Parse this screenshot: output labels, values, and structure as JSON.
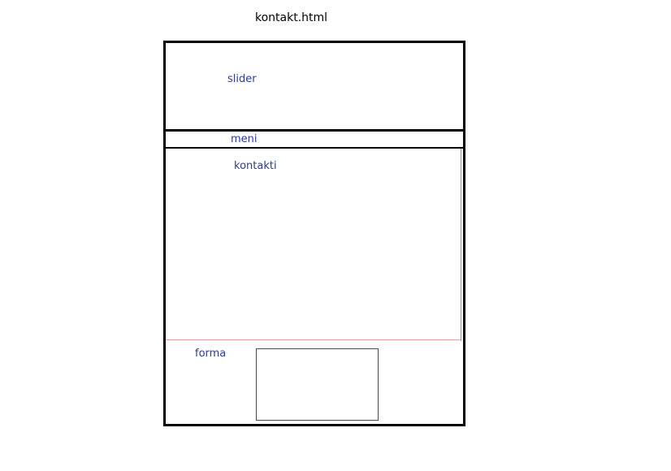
{
  "page": {
    "title": "kontakt.html"
  },
  "wireframe": {
    "sections": {
      "slider": "slider",
      "meni": "meni",
      "kontakti": "kontakti",
      "forma": "forma"
    },
    "colors": {
      "frame": "#000000",
      "label": "#2e3c8f",
      "form_box": "#c8102e",
      "divider": "#e6a0a8"
    }
  }
}
